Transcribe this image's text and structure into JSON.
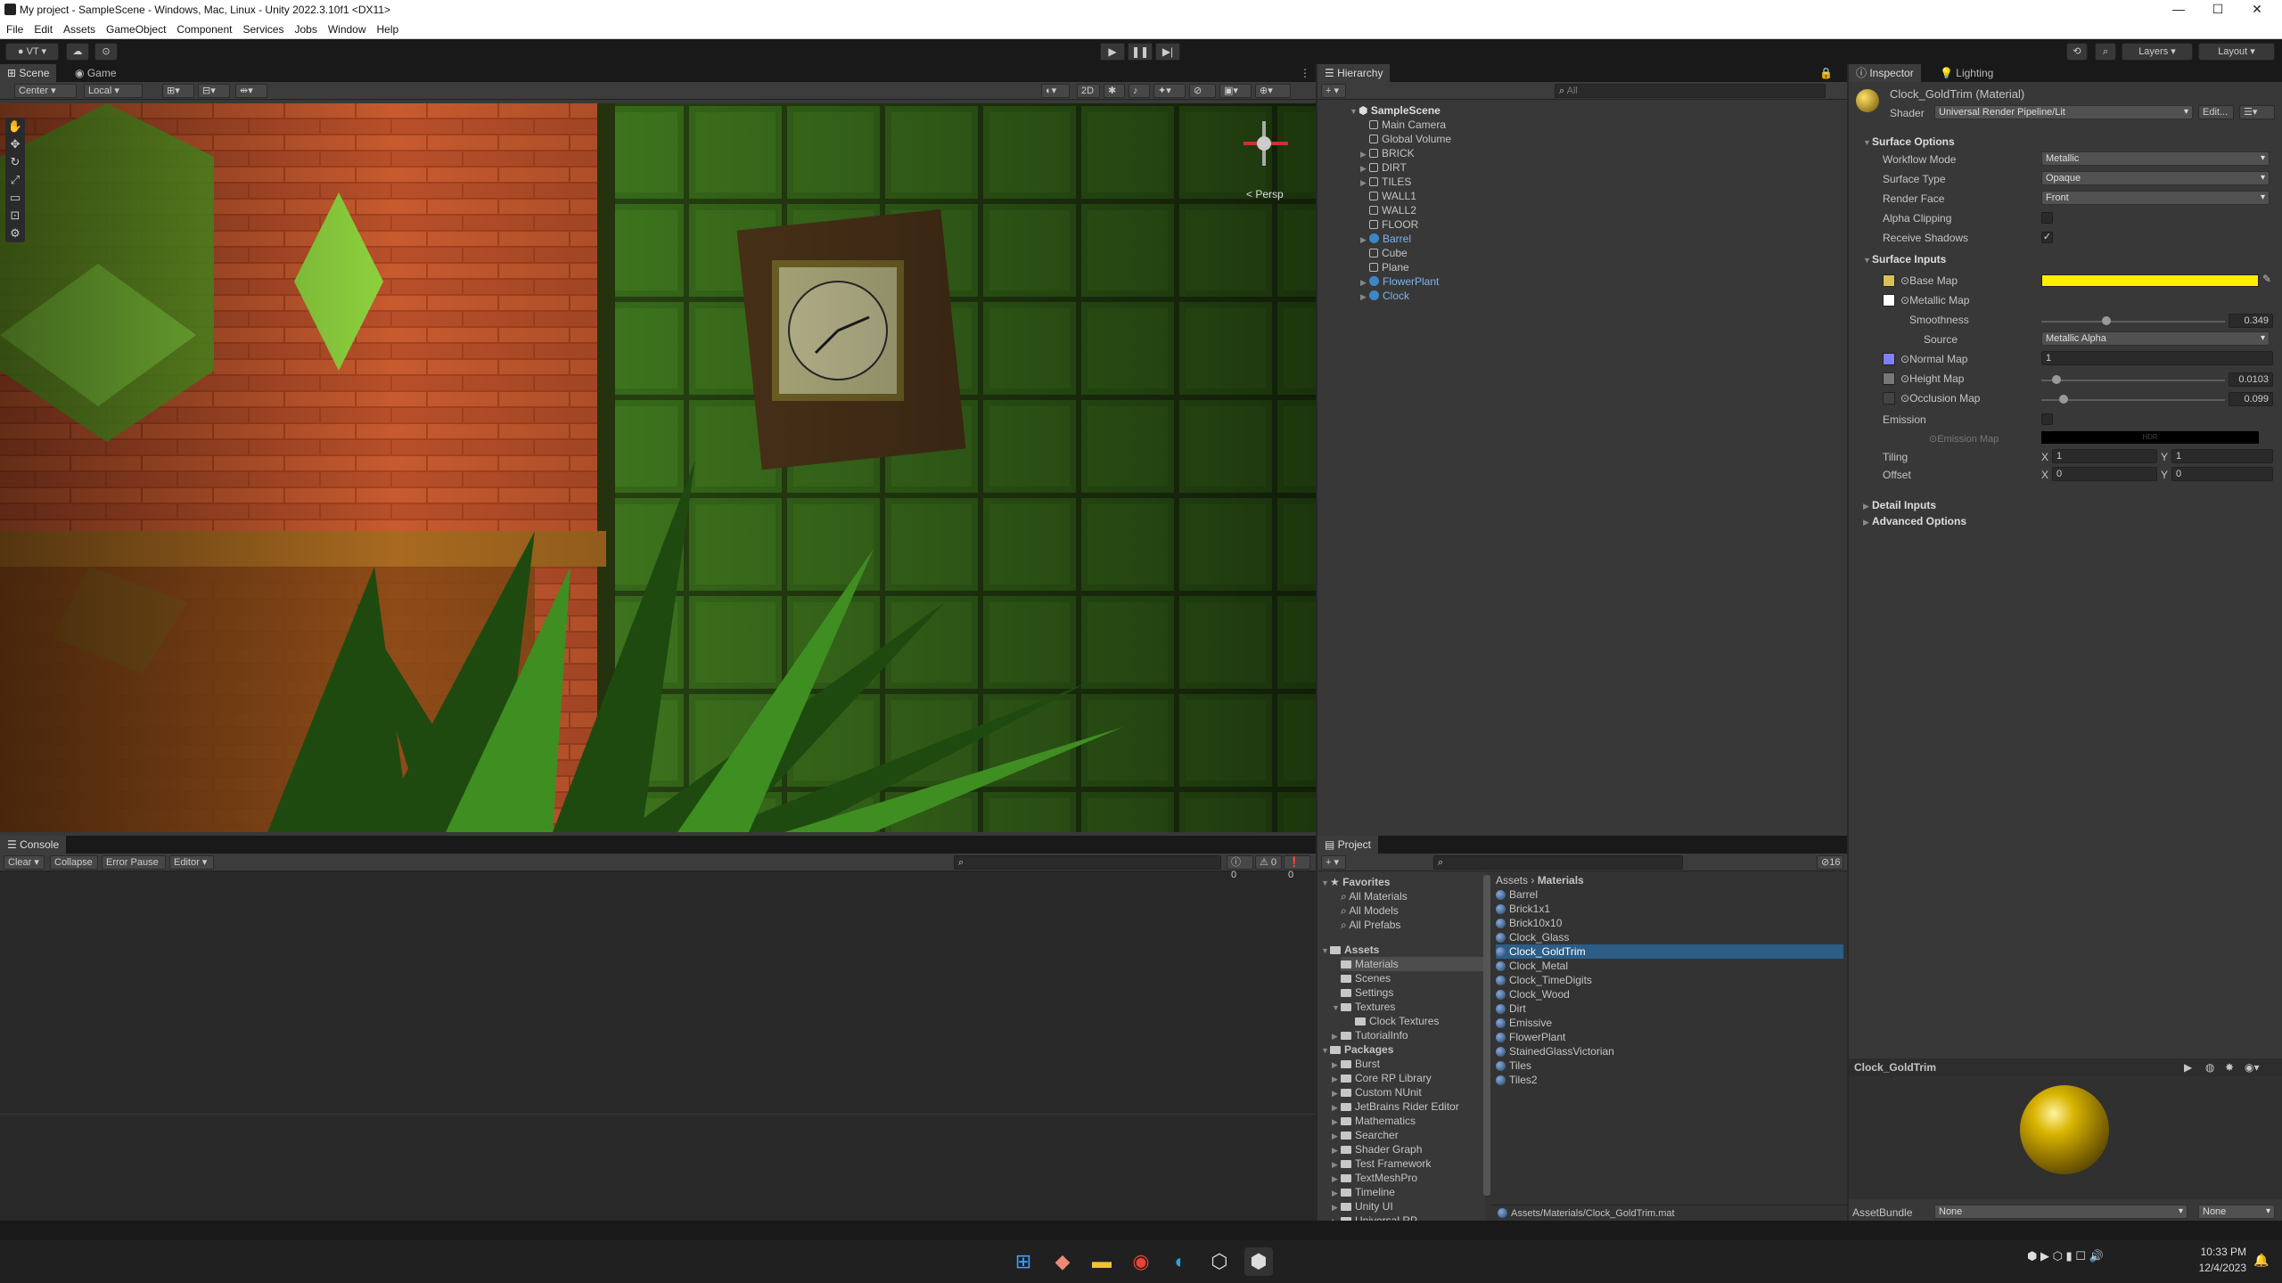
{
  "window": {
    "title": "My project - SampleScene - Windows, Mac, Linux - Unity 2022.3.10f1 <DX11>",
    "min": "—",
    "max": "☐",
    "close": "✕"
  },
  "menu": [
    "File",
    "Edit",
    "Assets",
    "GameObject",
    "Component",
    "Services",
    "Jobs",
    "Window",
    "Help"
  ],
  "toolbar": {
    "account": "VT",
    "layers": "Layers",
    "layout": "Layout"
  },
  "scene": {
    "tabs": [
      "Scene",
      "Game"
    ],
    "pivot": "Center",
    "space": "Local",
    "mode2d": "2D",
    "persp": "< Persp"
  },
  "hierarchy": {
    "tab": "Hierarchy",
    "search_placeholder": "All",
    "scene": "SampleScene",
    "items": [
      {
        "label": "Main Camera",
        "expand": false,
        "blue": false
      },
      {
        "label": "Global Volume",
        "expand": false,
        "blue": false
      },
      {
        "label": "BRICK",
        "expand": true,
        "blue": false
      },
      {
        "label": "DIRT",
        "expand": true,
        "blue": false
      },
      {
        "label": "TILES",
        "expand": true,
        "blue": false
      },
      {
        "label": "WALL1",
        "expand": false,
        "blue": false
      },
      {
        "label": "WALL2",
        "expand": false,
        "blue": false
      },
      {
        "label": "FLOOR",
        "expand": false,
        "blue": false
      },
      {
        "label": "Barrel",
        "expand": true,
        "blue": true
      },
      {
        "label": "Cube",
        "expand": false,
        "blue": false
      },
      {
        "label": "Plane",
        "expand": false,
        "blue": false
      },
      {
        "label": "FlowerPlant",
        "expand": true,
        "blue": true
      },
      {
        "label": "Clock",
        "expand": true,
        "blue": true
      }
    ]
  },
  "inspector": {
    "tabs": [
      "Inspector",
      "Lighting"
    ],
    "material": "Clock_GoldTrim (Material)",
    "shader_label": "Shader",
    "shader": "Universal Render Pipeline/Lit",
    "edit": "Edit...",
    "surface_options": "Surface Options",
    "workflow_label": "Workflow Mode",
    "workflow": "Metallic",
    "surface_type_label": "Surface Type",
    "surface_type": "Opaque",
    "render_face_label": "Render Face",
    "render_face": "Front",
    "alpha_clipping": "Alpha Clipping",
    "receive_shadows": "Receive Shadows",
    "surface_inputs": "Surface Inputs",
    "base_map": "Base Map",
    "metallic_map": "Metallic Map",
    "smoothness": "Smoothness",
    "smoothness_value": "0.349",
    "source": "Source",
    "source_value": "Metallic Alpha",
    "normal_map": "Normal Map",
    "normal_value": "1",
    "height_map": "Height Map",
    "height_value": "0.0103",
    "occlusion_map": "Occlusion Map",
    "occlusion_value": "0.099",
    "emission": "Emission",
    "emission_map": "Emission Map",
    "hdr": "HDR",
    "tiling": "Tiling",
    "offset": "Offset",
    "x": "X",
    "y": "Y",
    "tiling_x": "1",
    "tiling_y": "1",
    "offset_x": "0",
    "offset_y": "0",
    "detail_inputs": "Detail Inputs",
    "advanced_options": "Advanced Options",
    "preview_title": "Clock_GoldTrim",
    "asset_bundle": "AssetBundle",
    "bundle_value": "None",
    "bundle_variant": "None",
    "base_color": "#ffee00",
    "normal_color": "#7f7fff"
  },
  "console": {
    "tab": "Console",
    "clear": "Clear",
    "collapse": "Collapse",
    "error_pause": "Error Pause",
    "editor": "Editor",
    "count_log": "0",
    "count_warn": "0",
    "count_err": "0"
  },
  "project": {
    "tab": "Project",
    "count": "16",
    "breadcrumb_root": "Assets",
    "breadcrumb_leaf": "Materials",
    "favorites": "Favorites",
    "fav_items": [
      "All Materials",
      "All Models",
      "All Prefabs"
    ],
    "assets": "Assets",
    "asset_folders": [
      "Materials",
      "Scenes",
      "Settings",
      "Textures",
      "Clock Textures",
      "TutorialInfo"
    ],
    "packages": "Packages",
    "package_folders": [
      "Burst",
      "Core RP Library",
      "Custom NUnit",
      "JetBrains Rider Editor",
      "Mathematics",
      "Searcher",
      "Shader Graph",
      "Test Framework",
      "TextMeshPro",
      "Timeline",
      "Unity UI",
      "Universal RP"
    ],
    "materials": [
      "Barrel",
      "Brick1x1",
      "Brick10x10",
      "Clock_Glass",
      "Clock_GoldTrim",
      "Clock_Metal",
      "Clock_TimeDigits",
      "Clock_Wood",
      "Dirt",
      "Emissive",
      "FlowerPlant",
      "StainedGlassVictorian",
      "Tiles",
      "Tiles2"
    ],
    "selected_path": "Assets/Materials/Clock_GoldTrim.mat"
  },
  "taskbar": {
    "time": "10:33 PM",
    "date": "12/4/2023"
  }
}
